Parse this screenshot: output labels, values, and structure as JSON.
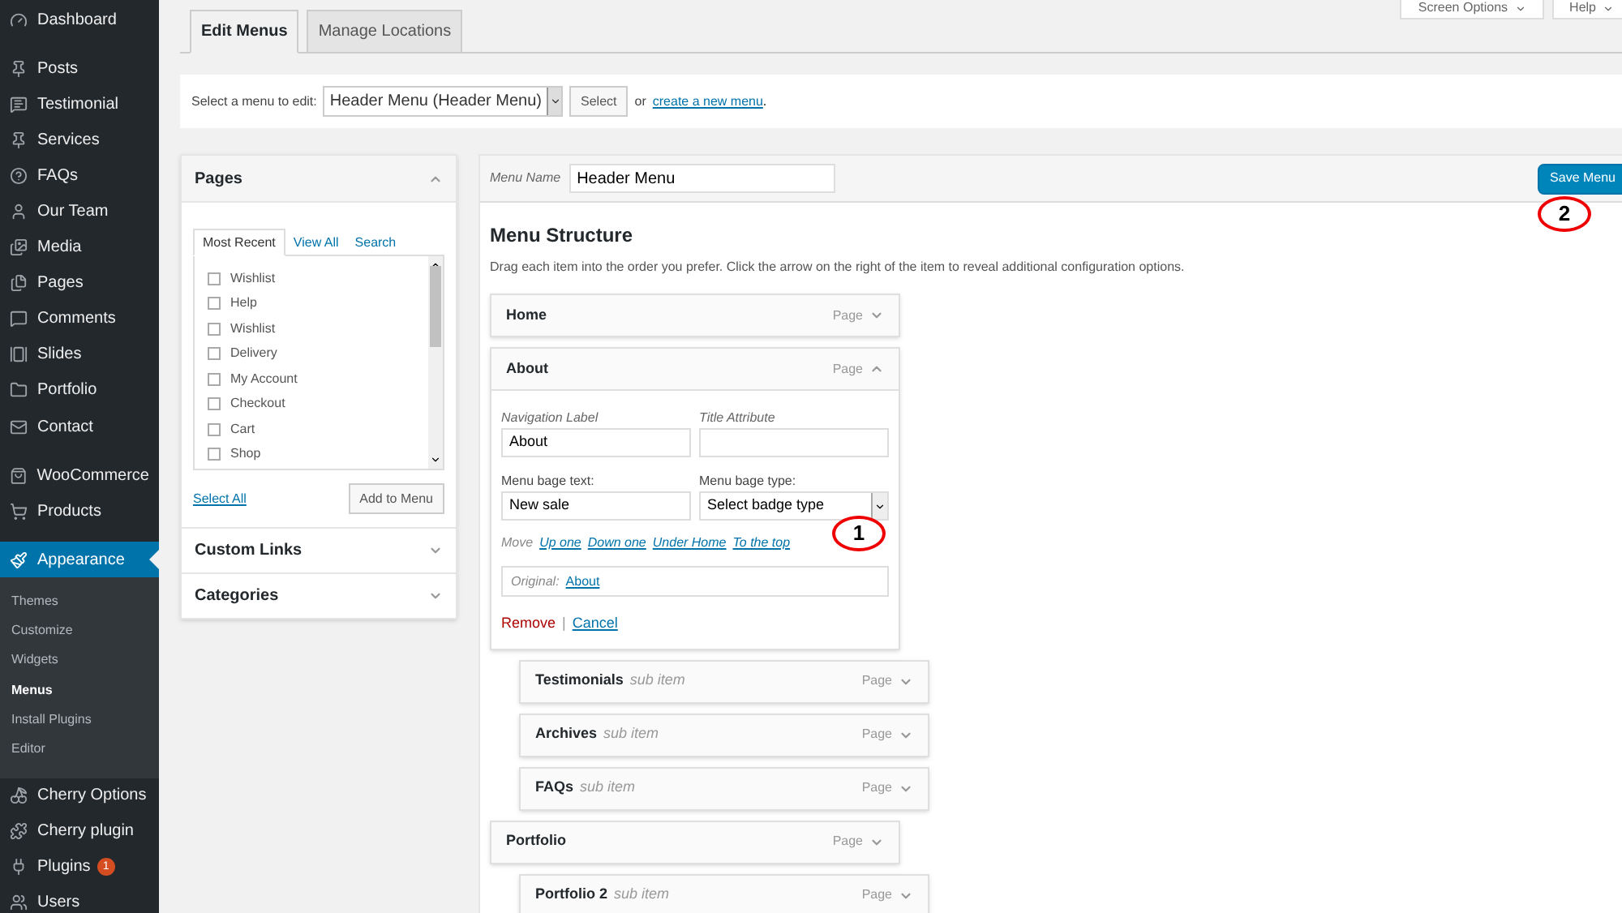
{
  "sidebar": {
    "groups": [
      [
        {
          "label": "Dashboard",
          "selected": false
        }
      ],
      [
        {
          "label": "Posts",
          "selected": false
        },
        {
          "label": "Testimonial",
          "selected": false
        },
        {
          "label": "Services",
          "selected": false
        },
        {
          "label": "FAQs",
          "selected": false
        },
        {
          "label": "Our Team",
          "selected": false
        },
        {
          "label": "Media",
          "selected": false
        },
        {
          "label": "Pages",
          "selected": false
        },
        {
          "label": "Comments",
          "selected": false
        },
        {
          "label": "Slides",
          "selected": false
        },
        {
          "label": "Portfolio",
          "selected": false
        },
        {
          "label": "Contact",
          "selected": false
        }
      ],
      [
        {
          "label": "WooCommerce",
          "selected": false
        },
        {
          "label": "Products",
          "selected": false
        }
      ],
      [
        {
          "label": "Appearance",
          "selected": true,
          "children": [
            {
              "label": "Themes",
              "selected": false
            },
            {
              "label": "Customize",
              "selected": false
            },
            {
              "label": "Widgets",
              "selected": false
            },
            {
              "label": "Menus",
              "selected": true
            },
            {
              "label": "Install Plugins",
              "selected": false
            },
            {
              "label": "Editor",
              "selected": false
            }
          ]
        },
        {
          "label": "Cherry Options",
          "selected": false
        },
        {
          "label": "Cherry plugin",
          "selected": false
        },
        {
          "label": "Plugins",
          "selected": false,
          "badge": "1"
        },
        {
          "label": "Users",
          "selected": false
        }
      ]
    ]
  },
  "top_buttons": [
    "Screen Options",
    "Help"
  ],
  "tabs": [
    {
      "label": "Edit Menus",
      "selected": true
    },
    {
      "label": "Manage Locations",
      "selected": false
    }
  ],
  "menu_select": {
    "label": "Select a menu to edit:",
    "value": "Header Menu (Header Menu)",
    "button": "Select",
    "or_text": "or",
    "link": "create a new menu",
    "end": "."
  },
  "pages_panel": {
    "title": "Pages",
    "tabs": [
      {
        "label": "Most Recent",
        "selected": true
      },
      {
        "label": "View All",
        "selected": false
      },
      {
        "label": "Search",
        "selected": false
      }
    ],
    "pages": [
      {
        "label": "Wishlist",
        "checked": false
      },
      {
        "label": "Help",
        "checked": false
      },
      {
        "label": "Wishlist",
        "checked": false
      },
      {
        "label": "Delivery",
        "checked": false
      },
      {
        "label": "My Account",
        "checked": false
      },
      {
        "label": "Checkout",
        "checked": false
      },
      {
        "label": "Cart",
        "checked": false
      },
      {
        "label": "Shop",
        "checked": false
      }
    ],
    "select_all": "Select All",
    "add_button": "Add to Menu"
  },
  "other_panels": [
    {
      "title": "Custom Links",
      "expanded": false
    },
    {
      "title": "Categories",
      "expanded": false
    }
  ],
  "menu_editor": {
    "name_label": "Menu Name",
    "name_value": "Header Menu",
    "save_button": "Save Menu",
    "heading": "Menu Structure",
    "description": "Drag each item into the order you prefer. Click the arrow on the right of the item to reveal additional configuration options.",
    "items": [
      {
        "title": "Home",
        "type": "Page",
        "expanded": false
      },
      {
        "title": "About",
        "type": "Page",
        "expanded": true,
        "settings": {
          "nav_label": "Navigation Label",
          "nav_value": "About",
          "title_label": "Title Attribute",
          "badge_text_label": "Menu bage text:",
          "badge_text_value": "New sale",
          "badge_type_label": "Menu bage type:",
          "badge_type_value": "Select badge type",
          "move_label": "Move",
          "move_links": [
            "Up one",
            "Down one",
            "Under Home",
            "To the top"
          ],
          "original_label": "Original:",
          "original_link": "About",
          "remove": "Remove",
          "separator": "|",
          "cancel": "Cancel"
        },
        "children": [
          {
            "title": "Testimonials",
            "sub_label": "sub item",
            "type": "Page",
            "expanded": false
          },
          {
            "title": "Archives",
            "sub_label": "sub item",
            "type": "Page",
            "expanded": false
          },
          {
            "title": "FAQs",
            "sub_label": "sub item",
            "type": "Page",
            "expanded": false
          }
        ]
      },
      {
        "title": "Portfolio",
        "type": "Page",
        "expanded": false,
        "children": [
          {
            "title": "Portfolio 2",
            "sub_label": "sub item",
            "type": "Page",
            "expanded": false
          }
        ]
      }
    ]
  },
  "annotations": [
    {
      "label": "1"
    },
    {
      "label": "2"
    }
  ]
}
